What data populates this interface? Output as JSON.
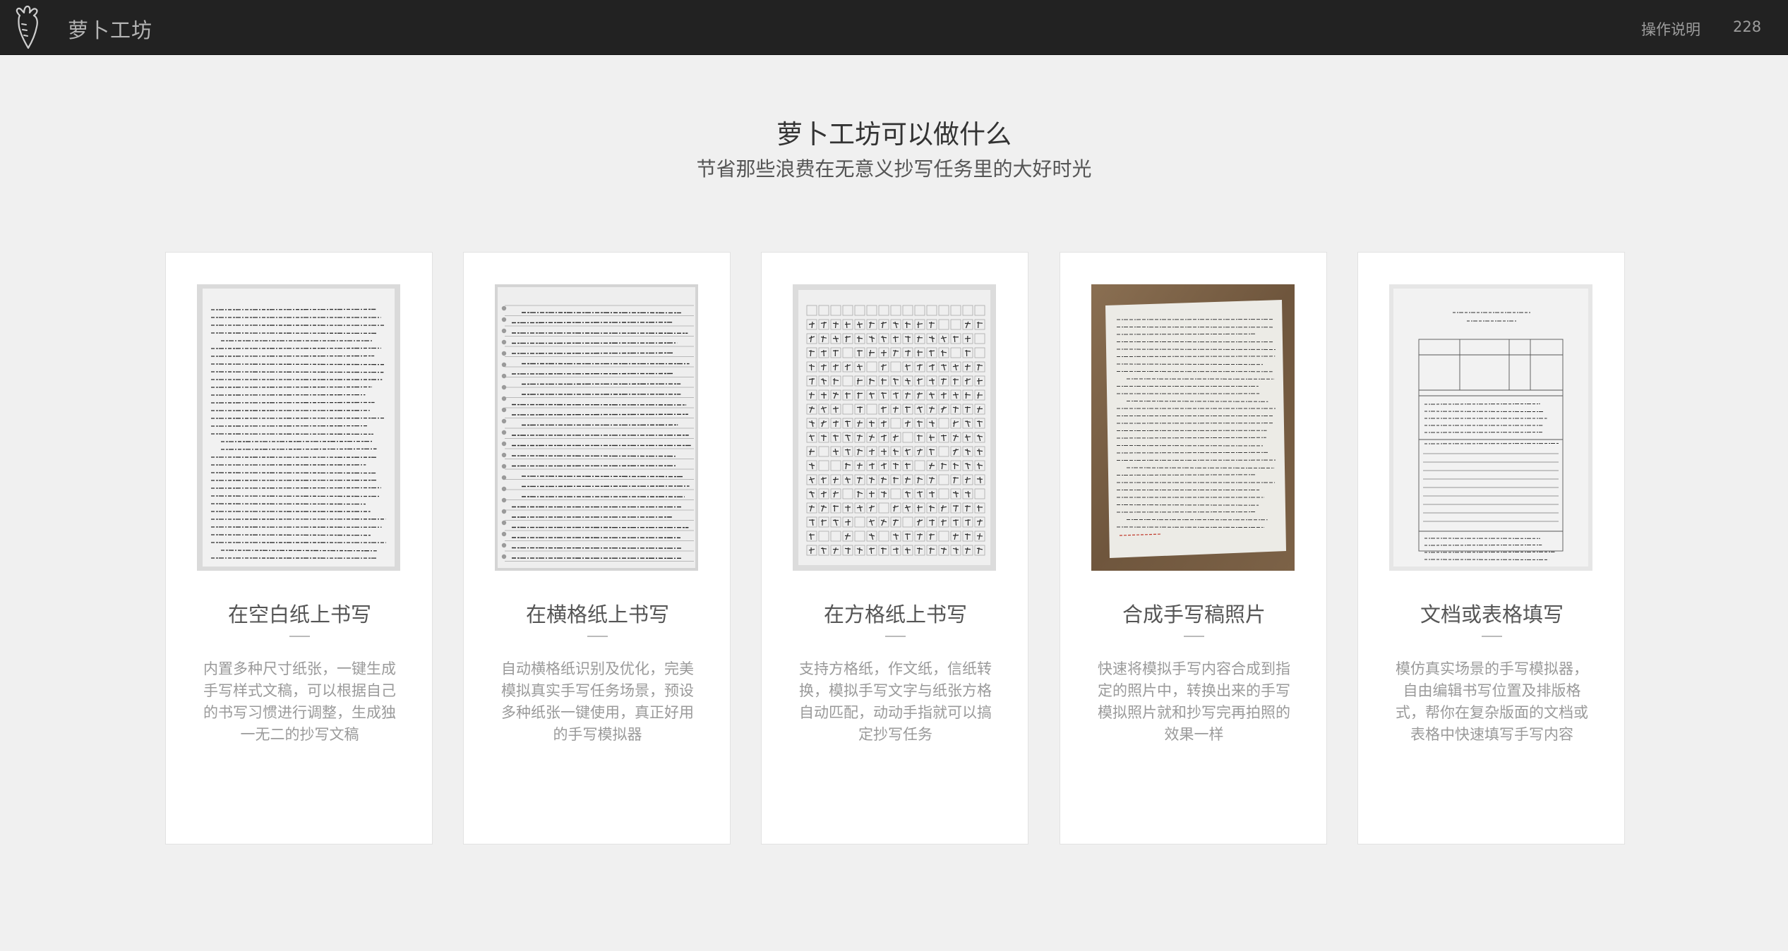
{
  "navbar": {
    "brand": "萝卜工坊",
    "help_label": "操作说明",
    "count_label": "228",
    "logo_icon": "carrot-icon"
  },
  "hero": {
    "title": "萝卜工坊可以做什么",
    "subtitle": "节省那些浪费在无意义抄写任务里的大好时光"
  },
  "features": [
    {
      "title": "在空白纸上书写",
      "description": "内置多种尺寸纸张，一键生成手写样式文稿，可以根据自己的书写习惯进行调整，生成独一无二的抄写文稿",
      "image": "blank-paper-handwriting-image"
    },
    {
      "title": "在横格纸上书写",
      "description": "自动横格纸识别及优化，完美模拟真实手写任务场景，预设多种纸张一键使用，真正好用的手写模拟器",
      "image": "lined-paper-handwriting-image"
    },
    {
      "title": "在方格纸上书写",
      "description": "支持方格纸，作文纸，信纸转换，模拟手写文字与纸张方格自动匹配，动动手指就可以搞定抄写任务",
      "image": "grid-paper-handwriting-image"
    },
    {
      "title": "合成手写稿照片",
      "description": "快速将模拟手写内容合成到指定的照片中，转换出来的手写模拟照片就和抄写完再拍照的效果一样",
      "image": "handwriting-photo-image"
    },
    {
      "title": "文档或表格填写",
      "description": "模仿真实场景的手写模拟器，自由编辑书写位置及排版格式，帮你在复杂版面的文档或表格中快速填写手写内容",
      "image": "form-filling-image"
    }
  ],
  "colors": {
    "navbar_bg": "#222222",
    "page_bg": "#f0f0f0",
    "card_bg": "#ffffff",
    "desc_text": "#9a9a9a",
    "desk_wood": "#7a6148"
  }
}
